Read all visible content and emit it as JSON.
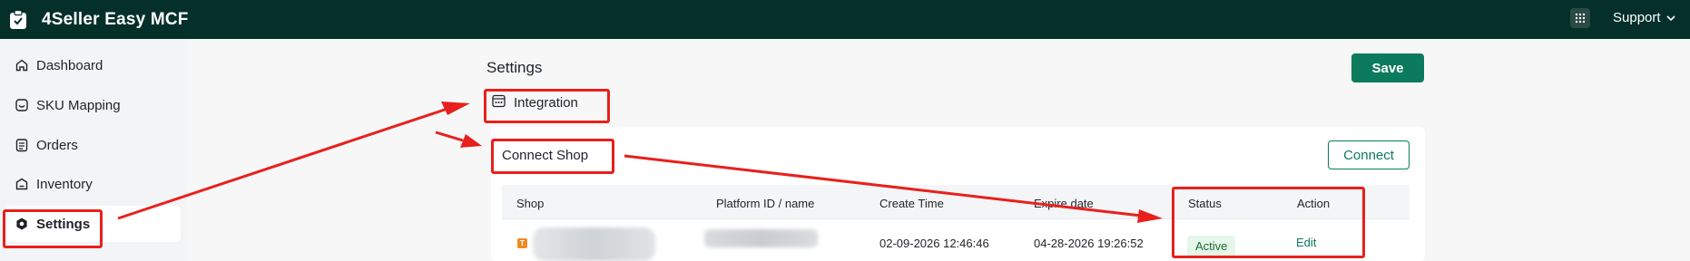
{
  "app": {
    "name": "4Seller Easy MCF",
    "support_label": "Support"
  },
  "sidebar": {
    "items": [
      {
        "label": "Dashboard",
        "icon": "home-icon"
      },
      {
        "label": "SKU Mapping",
        "icon": "mapping-icon"
      },
      {
        "label": "Orders",
        "icon": "orders-icon"
      },
      {
        "label": "Inventory",
        "icon": "inventory-icon"
      },
      {
        "label": "Settings",
        "icon": "settings-icon"
      }
    ]
  },
  "main": {
    "title": "Settings",
    "save_label": "Save",
    "integration_tab": "Integration",
    "connect_shop": {
      "title": "Connect Shop",
      "connect_label": "Connect",
      "columns": [
        "Shop",
        "Platform ID / name",
        "Create Time",
        "Expire date",
        "Status",
        "Action"
      ],
      "rows": [
        {
          "create_time": "02-09-2026 12:46:46",
          "expire_date": "04-28-2026 19:26:52",
          "status": "Active",
          "action": "Edit"
        }
      ]
    }
  },
  "colors": {
    "topbar": "#05302a",
    "accent": "#0c7a5c",
    "annotation": "#e8201d",
    "status_active_bg": "#e5f6ea"
  }
}
